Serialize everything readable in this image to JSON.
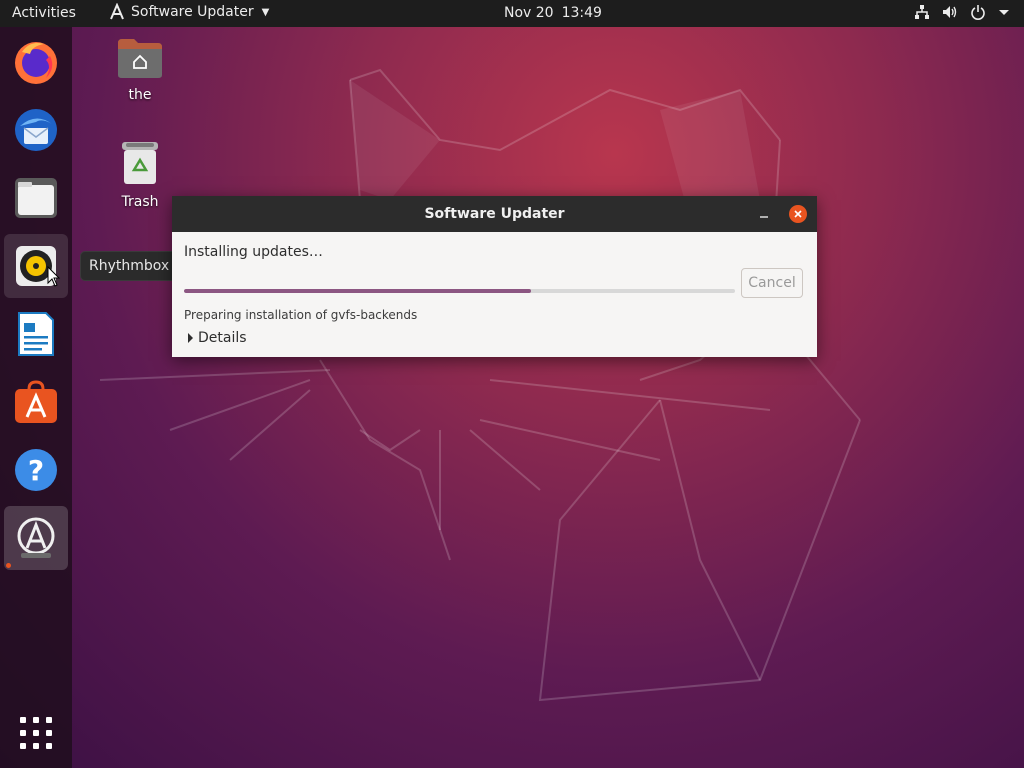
{
  "topbar": {
    "activities": "Activities",
    "app_menu": {
      "label": "Software Updater",
      "icon": "software-updater-icon"
    },
    "clock": {
      "date": "Nov 20",
      "time": "13:49"
    },
    "tray": [
      "network-icon",
      "volume-icon",
      "power-icon",
      "chevron-down-icon"
    ]
  },
  "dock": {
    "items": [
      {
        "name": "Firefox",
        "icon": "firefox-icon"
      },
      {
        "name": "Thunderbird",
        "icon": "thunderbird-icon"
      },
      {
        "name": "Files",
        "icon": "files-icon"
      },
      {
        "name": "Rhythmbox",
        "icon": "rhythmbox-icon"
      },
      {
        "name": "LibreOffice Writer",
        "icon": "writer-icon"
      },
      {
        "name": "Ubuntu Software",
        "icon": "software-center-icon"
      },
      {
        "name": "Help",
        "icon": "help-icon"
      },
      {
        "name": "Software Updater",
        "icon": "software-updater-icon",
        "running": true
      }
    ],
    "tooltip": "Rhythmbox",
    "show_apps": "app-grid-icon"
  },
  "desktop": {
    "icons": [
      {
        "label": "the",
        "icon": "home-folder-icon"
      },
      {
        "label": "Trash",
        "icon": "trash-icon"
      }
    ]
  },
  "dialog": {
    "title": "Software Updater",
    "heading": "Installing updates…",
    "progress": 0.63,
    "cancel_label": "Cancel",
    "status": "Preparing installation of gvfs-backends",
    "details_label": "Details"
  },
  "colors": {
    "accent": "#e95420",
    "progress": "#8c5682",
    "topbar": "#1d1d1d"
  }
}
